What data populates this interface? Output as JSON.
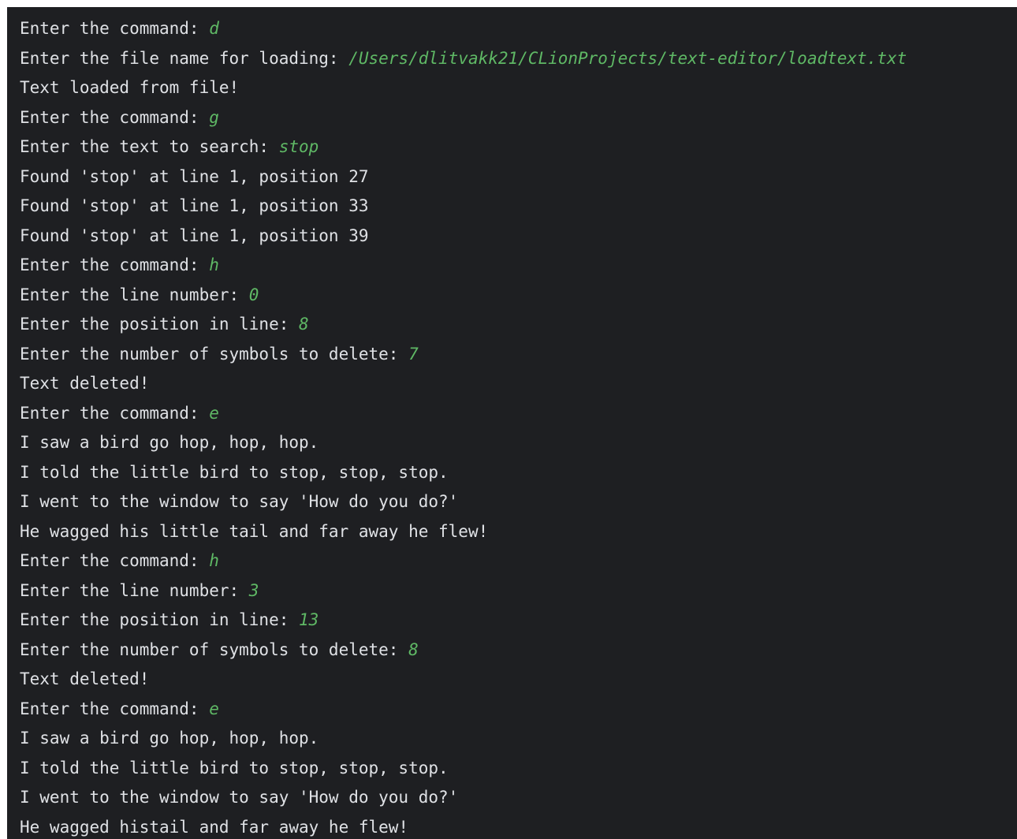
{
  "console": {
    "colors": {
      "background": "#1e1f22",
      "output_text": "#dfe1e5",
      "user_input": "#5fb865"
    },
    "lines": [
      {
        "text": "Enter the command: ",
        "input": "d"
      },
      {
        "text": "Enter the file name for loading: ",
        "input": "/Users/dlitvakk21/CLionProjects/text-editor/loadtext.txt"
      },
      {
        "text": "Text loaded from file!",
        "input": ""
      },
      {
        "text": "Enter the command: ",
        "input": "g"
      },
      {
        "text": "Enter the text to search: ",
        "input": "stop"
      },
      {
        "text": "Found 'stop' at line 1, position 27",
        "input": ""
      },
      {
        "text": "Found 'stop' at line 1, position 33",
        "input": ""
      },
      {
        "text": "Found 'stop' at line 1, position 39",
        "input": ""
      },
      {
        "text": "Enter the command: ",
        "input": "h"
      },
      {
        "text": "Enter the line number: ",
        "input": "0"
      },
      {
        "text": "Enter the position in line: ",
        "input": "8"
      },
      {
        "text": "Enter the number of symbols to delete: ",
        "input": "7"
      },
      {
        "text": "Text deleted!",
        "input": ""
      },
      {
        "text": "Enter the command: ",
        "input": "e"
      },
      {
        "text": "I saw a bird go hop, hop, hop.",
        "input": ""
      },
      {
        "text": "I told the little bird to stop, stop, stop.",
        "input": ""
      },
      {
        "text": "I went to the window to say 'How do you do?'",
        "input": ""
      },
      {
        "text": "He wagged his little tail and far away he flew!",
        "input": ""
      },
      {
        "text": "Enter the command: ",
        "input": "h"
      },
      {
        "text": "Enter the line number: ",
        "input": "3"
      },
      {
        "text": "Enter the position in line: ",
        "input": "13"
      },
      {
        "text": "Enter the number of symbols to delete: ",
        "input": "8"
      },
      {
        "text": "Text deleted!",
        "input": ""
      },
      {
        "text": "Enter the command: ",
        "input": "e"
      },
      {
        "text": "I saw a bird go hop, hop, hop.",
        "input": ""
      },
      {
        "text": "I told the little bird to stop, stop, stop.",
        "input": ""
      },
      {
        "text": "I went to the window to say 'How do you do?'",
        "input": ""
      },
      {
        "text": "He wagged histail and far away he flew!",
        "input": ""
      }
    ]
  }
}
